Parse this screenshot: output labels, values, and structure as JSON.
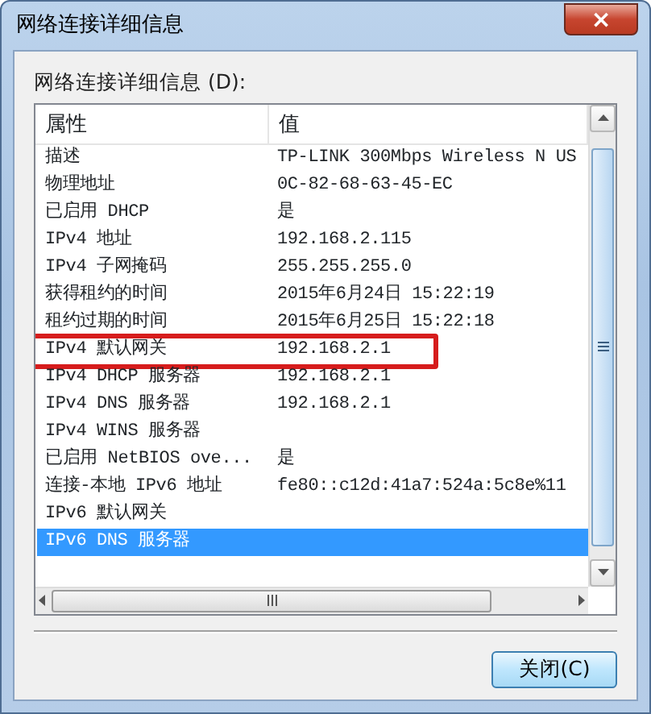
{
  "window": {
    "title": "网络连接详细信息",
    "close": "×"
  },
  "label": "网络连接详细信息 (D):",
  "table": {
    "columns": [
      "属性",
      "值"
    ],
    "rows": [
      {
        "property": "描述",
        "value": "TP-LINK 300Mbps Wireless N US",
        "selected": false,
        "highlighted": false
      },
      {
        "property": "物理地址",
        "value": "0C-82-68-63-45-EC",
        "selected": false,
        "highlighted": false
      },
      {
        "property": "已启用 DHCP",
        "value": "是",
        "selected": false,
        "highlighted": false
      },
      {
        "property": "IPv4 地址",
        "value": "192.168.2.115",
        "selected": false,
        "highlighted": false
      },
      {
        "property": "IPv4 子网掩码",
        "value": "255.255.255.0",
        "selected": false,
        "highlighted": false
      },
      {
        "property": "获得租约的时间",
        "value": "2015年6月24日 15:22:19",
        "selected": false,
        "highlighted": false
      },
      {
        "property": "租约过期的时间",
        "value": "2015年6月25日 15:22:18",
        "selected": false,
        "highlighted": false
      },
      {
        "property": "IPv4 默认网关",
        "value": "192.168.2.1",
        "selected": false,
        "highlighted": true
      },
      {
        "property": "IPv4 DHCP 服务器",
        "value": "192.168.2.1",
        "selected": false,
        "highlighted": false
      },
      {
        "property": "IPv4 DNS 服务器",
        "value": "192.168.2.1",
        "selected": false,
        "highlighted": false
      },
      {
        "property": "IPv4 WINS 服务器",
        "selected": false,
        "highlighted": false
      },
      {
        "property": "已启用 NetBIOS ove...",
        "value": "是",
        "selected": false,
        "highlighted": false
      },
      {
        "property": "连接-本地 IPv6 地址",
        "value": "fe80::c12d:41a7:524a:5c8e%11",
        "selected": false,
        "highlighted": false
      },
      {
        "property": "IPv6 默认网关",
        "selected": false,
        "highlighted": false
      },
      {
        "property": "IPv6 DNS 服务器",
        "selected": true,
        "highlighted": false
      }
    ]
  },
  "buttons": [
    {
      "label": "关闭(C)"
    }
  ]
}
